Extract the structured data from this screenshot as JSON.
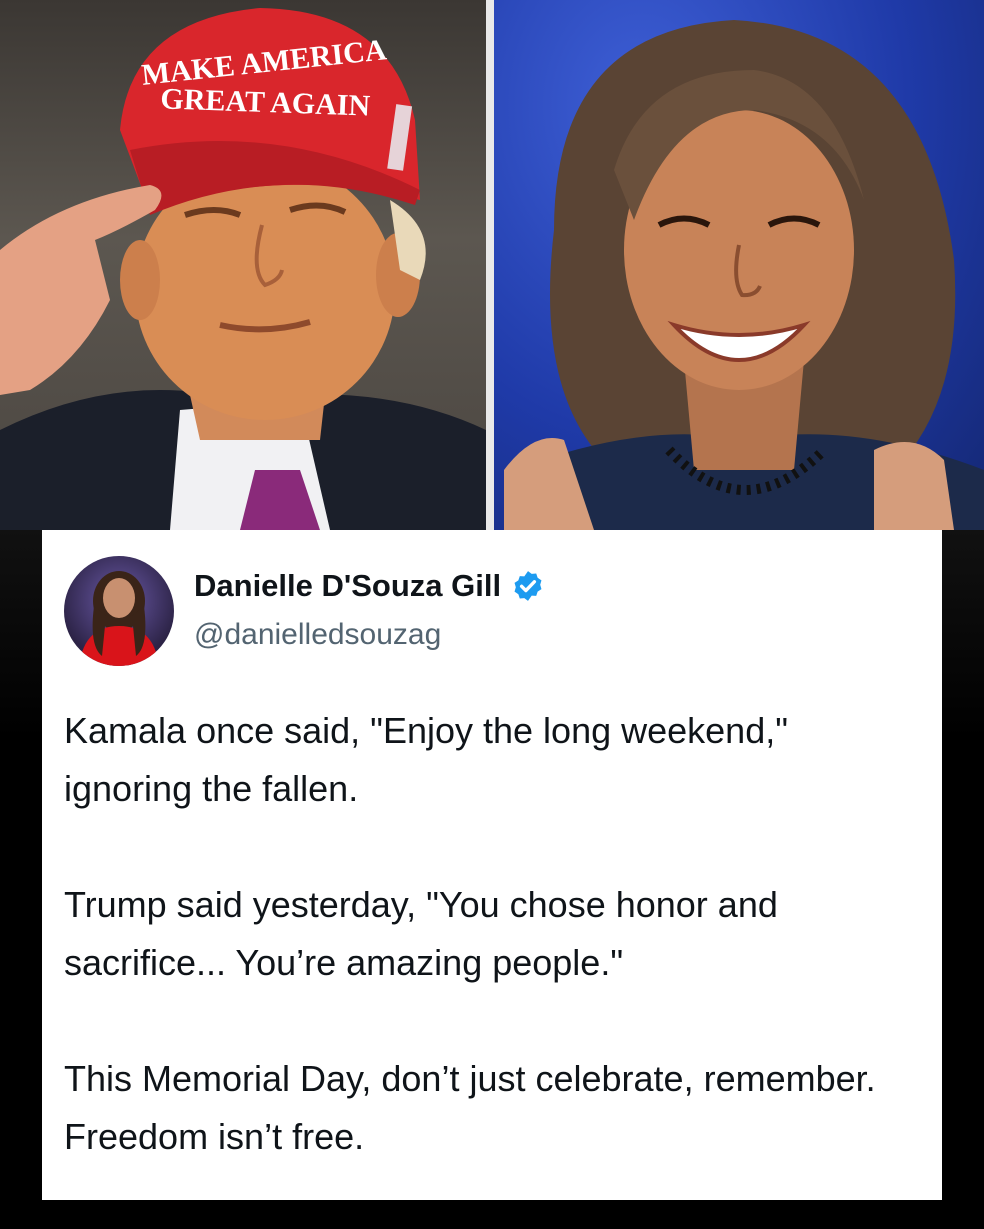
{
  "collage": {
    "left_photo": {
      "hat_line1": "MAKE AMERICA",
      "hat_line2": "GREAT AGAIN"
    },
    "right_photo": {}
  },
  "tweet": {
    "display_name": "Danielle D'Souza Gill",
    "handle": "@danielledsouzag",
    "verified": true,
    "paragraphs": [
      "Kamala once said, \"Enjoy the long weekend,\" ignoring the fallen.",
      "Trump said yesterday, \"You chose honor and sacrifice... You’re amazing people.\"",
      "This Memorial Day, don’t just celebrate, remember. Freedom isn’t free."
    ]
  },
  "colors": {
    "background": "#000000",
    "card": "#ffffff",
    "name_text": "#0f1419",
    "handle_text": "#536471",
    "verified_badge": "#1d9bf0",
    "hat_red": "#d9262c",
    "right_backdrop": "#1f3aa8"
  }
}
